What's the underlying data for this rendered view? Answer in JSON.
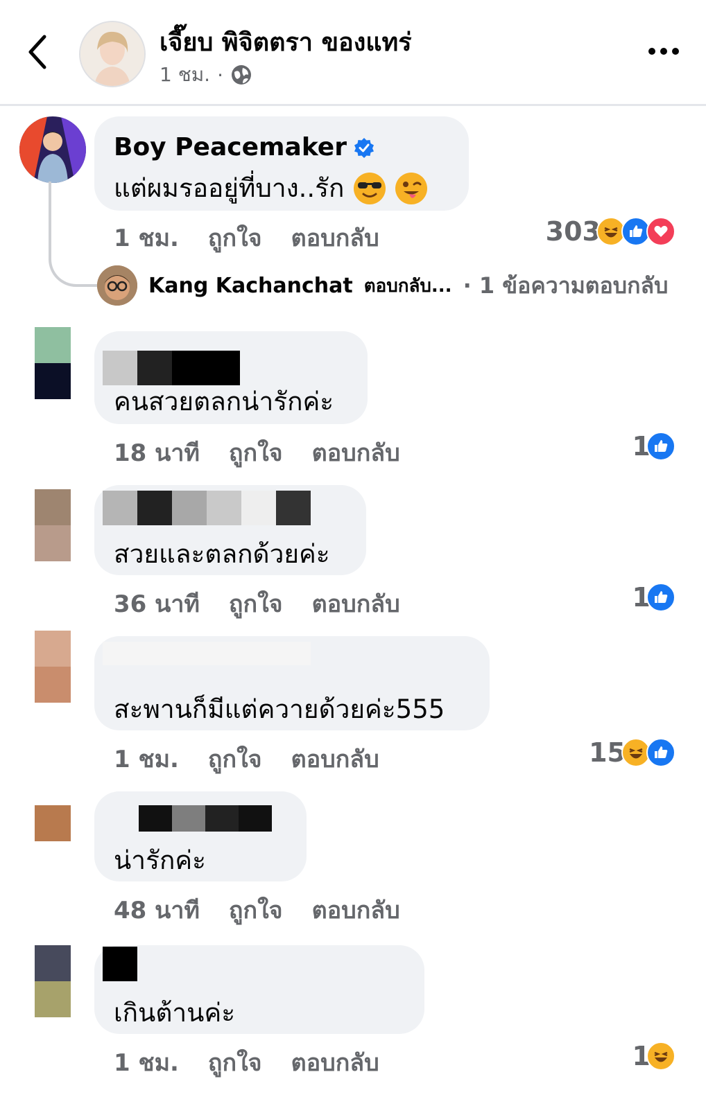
{
  "header": {
    "page_name": "เจี๊ยบ พิจิตตรา ของแทร่",
    "time": "1 ชม.",
    "separator": "·"
  },
  "thread": {
    "author": "Boy Peacemaker",
    "text": "แต่ผมรออยู่ที่บาง..รัก",
    "time": "1 ชม.",
    "like_label": "ถูกใจ",
    "reply_label": "ตอบกลับ",
    "reaction_count": "303",
    "reactions": [
      "haha",
      "like",
      "love"
    ],
    "reply_preview": {
      "author": "Kang Kachanchat",
      "snippet": "ตอบกลับ...",
      "count_text": "· 1 ข้อความตอบกลับ"
    }
  },
  "comments": [
    {
      "text": "คนสวยตลกน่ารักค่ะ",
      "time": "18 นาที",
      "like_label": "ถูกใจ",
      "reply_label": "ตอบกลับ",
      "reaction_count": "1",
      "reactions": [
        "like"
      ]
    },
    {
      "text": "สวยและตลกด้วยค่ะ",
      "time": "36 นาที",
      "like_label": "ถูกใจ",
      "reply_label": "ตอบกลับ",
      "reaction_count": "1",
      "reactions": [
        "like"
      ]
    },
    {
      "text": "สะพานก็มีแต่ควายด้วยค่ะ555",
      "time": "1 ชม.",
      "like_label": "ถูกใจ",
      "reply_label": "ตอบกลับ",
      "reaction_count": "15",
      "reactions": [
        "haha",
        "like"
      ]
    },
    {
      "text": "น่ารักค่ะ",
      "time": "48 นาที",
      "like_label": "ถูกใจ",
      "reply_label": "ตอบกลับ",
      "reaction_count": "",
      "reactions": []
    },
    {
      "text": "เกินต้านค่ะ",
      "time": "1 ชม.",
      "like_label": "ถูกใจ",
      "reply_label": "ตอบกลับ",
      "reaction_count": "1",
      "reactions": [
        "haha"
      ]
    }
  ],
  "colors": {
    "like": "#1877f2",
    "love": "#f33e58",
    "haha": "#f7b125",
    "verified": "#1877f2",
    "bubble": "#f0f2f5",
    "secondary_text": "#65676b"
  }
}
